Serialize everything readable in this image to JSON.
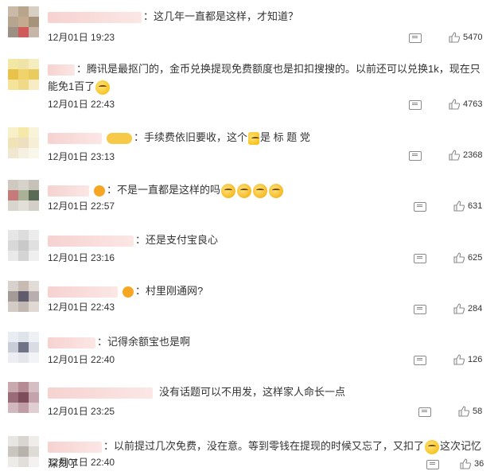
{
  "comments": [
    {
      "text": "这几年一直都是这样，才知道？",
      "time": "12月01日 19:23",
      "likes": "5470"
    },
    {
      "text": "腾讯是最抠门的，金币兑换提现免费额度也是扣扣搜搜的。以前还可以兑换1k，现在只能免1百了",
      "time": "12月01日 22:43",
      "likes": "4763"
    },
    {
      "text": "手续费依旧要收，这个",
      "text2": "是 标 题 党",
      "time": "12月01日 23:13",
      "likes": "2368"
    },
    {
      "text": "不是一直都是这样的吗",
      "time": "12月01日 22:57",
      "likes": "631"
    },
    {
      "text": "还是支付宝良心",
      "time": "12月01日 23:16",
      "likes": "625"
    },
    {
      "text": "村里刚通网?",
      "time": "12月01日 22:43",
      "likes": "284"
    },
    {
      "text": "记得余额宝也是啊",
      "time": "12月01日 22:40",
      "likes": "126"
    },
    {
      "text": "没有话题可以不用发，这样家人命长一点",
      "time": "12月01日 23:25",
      "likes": "58"
    },
    {
      "text": "以前提过几次免费，没在意。等到零钱在提现的时候又忘了，又扣了",
      "text2": "这次记忆深刻了",
      "time": "12月01日 22:40",
      "likes": "36"
    }
  ],
  "icons": {
    "reply": "comment-icon",
    "like": "thumbs-up-icon",
    "emoji": "emoji-icon"
  },
  "colors": {
    "name_blur": "#f6d2d0",
    "text": "#333333",
    "icon": "#8a8a8a"
  }
}
